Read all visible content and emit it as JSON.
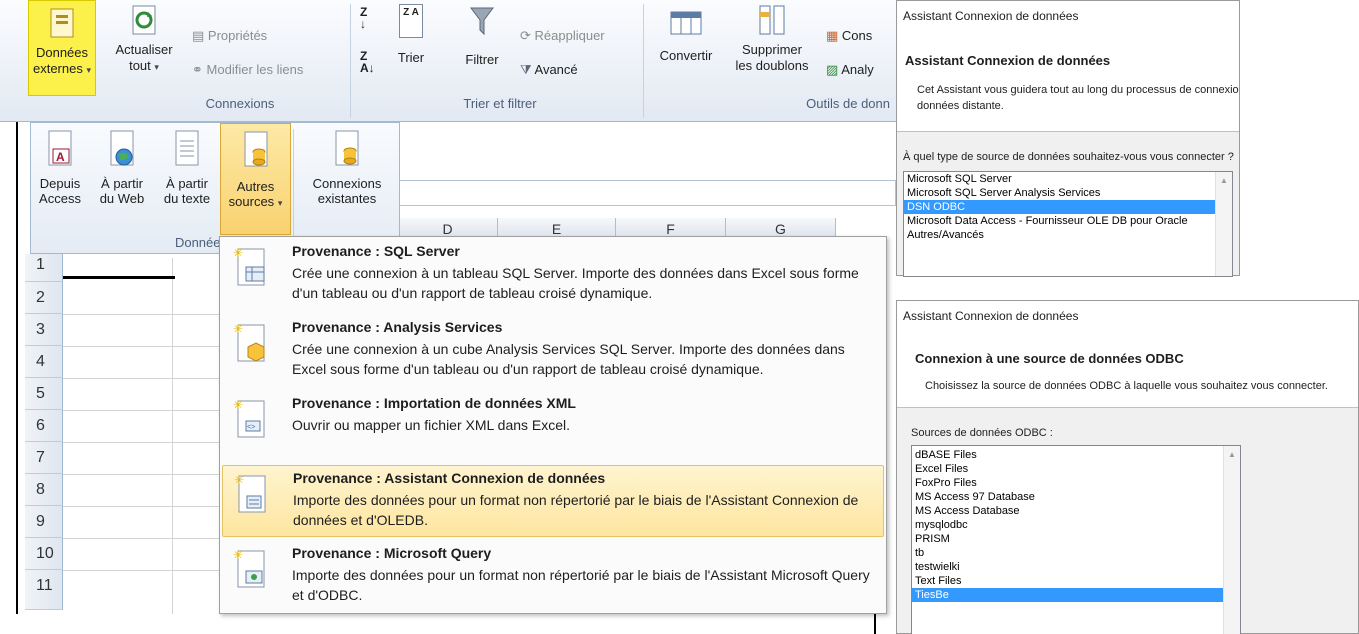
{
  "ribbon": {
    "donnees_externes": {
      "line1": "Données",
      "line2": "externes",
      "caret": "▾"
    },
    "actualiser": {
      "line1": "Actualiser",
      "line2": "tout",
      "caret": "▾"
    },
    "proprietes": "Propriétés",
    "modifier_liens": "Modifier les liens",
    "connexions_group": "Connexions",
    "trier": "Trier",
    "filtrer": "Filtrer",
    "reappliquer": "Réappliquer",
    "avance": "Avancé",
    "trier_group": "Trier et filtrer",
    "convertir": "Convertir",
    "supprimer": {
      "line1": "Supprimer",
      "line2": "les doublons"
    },
    "cons": "Cons",
    "analy": "Analy",
    "outils_group": "Outils de donn",
    "accent": "#fcf04a"
  },
  "data_panel": {
    "buttons": [
      {
        "line1": "Depuis",
        "line2": "Access"
      },
      {
        "line1": "À partir",
        "line2": "du Web"
      },
      {
        "line1": "À partir",
        "line2": "du texte"
      },
      {
        "line1": "Autres",
        "line2": "sources",
        "caret": "▾"
      },
      {
        "line1": "Connexions",
        "line2": "existantes"
      }
    ],
    "group_label": "Données"
  },
  "sheet": {
    "rows": [
      "1",
      "2",
      "3",
      "4",
      "5",
      "6",
      "7",
      "8",
      "9",
      "10",
      "11"
    ],
    "columns": [
      "D",
      "E",
      "F",
      "G"
    ]
  },
  "menu": {
    "items": [
      {
        "title": "Provenance : SQL Server",
        "desc": "Crée une connexion à un tableau SQL Server. Importe des données dans Excel sous forme d'un tableau ou d'un rapport de tableau croisé dynamique."
      },
      {
        "title": "Provenance : Analysis Services",
        "desc": "Crée une connexion à un cube Analysis Services SQL Server. Importe des données dans Excel sous forme d'un tableau ou d'un rapport de tableau croisé dynamique."
      },
      {
        "title": "Provenance : Importation de données XML",
        "desc": "Ouvrir ou mapper un fichier XML dans Excel."
      },
      {
        "title": "Provenance : Assistant Connexion de données",
        "desc": "Importe des données pour un format non répertorié par le biais de l'Assistant Connexion de données et d'OLEDB."
      },
      {
        "title": "Provenance : Microsoft Query",
        "desc": "Importe des données pour un format non répertorié par le biais de l'Assistant Microsoft Query et d'ODBC."
      }
    ]
  },
  "dialog1": {
    "window_title": "Assistant Connexion de données",
    "heading": "Assistant Connexion de données",
    "intro_line1": "Cet Assistant vous guidera tout au long du processus de connexio",
    "intro_line2": "données distante.",
    "question": "À quel type de source de données souhaitez-vous vous connecter ?",
    "options": [
      "Microsoft SQL Server",
      "Microsoft SQL Server Analysis Services",
      "DSN ODBC",
      "Microsoft Data Access - Fournisseur OLE DB pour Oracle",
      "Autres/Avancés"
    ],
    "selected": "DSN ODBC"
  },
  "dialog2": {
    "window_title": "Assistant Connexion de données",
    "heading": "Connexion à une source de données ODBC",
    "intro": "Choisissez la source de données ODBC à laquelle vous souhaitez vous connecter.",
    "list_label": "Sources de données ODBC :",
    "options": [
      "dBASE Files",
      "Excel Files",
      "FoxPro Files",
      "MS Access 97 Database",
      "MS Access Database",
      "mysqlodbc",
      "PRISM",
      "tb",
      "testwielki",
      "Text Files",
      "TiesBe"
    ],
    "selected": "TiesBe"
  }
}
